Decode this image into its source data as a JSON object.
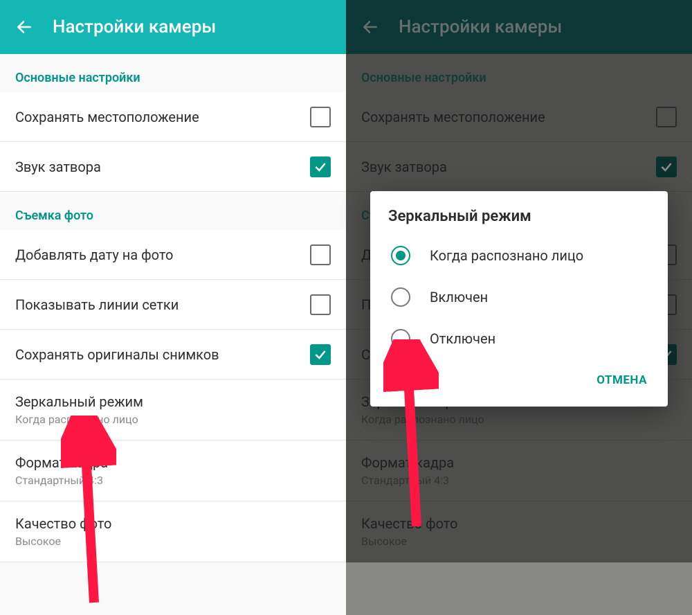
{
  "left": {
    "header": {
      "title": "Настройки камеры"
    },
    "sections": {
      "basic": {
        "title": "Основные настройки",
        "items": [
          {
            "label": "Сохранять местоположение",
            "checked": false
          },
          {
            "label": "Звук затвора",
            "checked": true
          }
        ]
      },
      "photo": {
        "title": "Съемка фото",
        "items": [
          {
            "label": "Добавлять дату на фото",
            "checked": false
          },
          {
            "label": "Показывать линии сетки",
            "checked": false
          },
          {
            "label": "Сохранять оригиналы снимков",
            "checked": true
          }
        ],
        "subitems": [
          {
            "label": "Зеркальный режим",
            "sub": "Когда распознано лицо"
          },
          {
            "label": "Формат кадра",
            "sub": "Стандартный 4:3"
          },
          {
            "label": "Качество фото",
            "sub": "Высокое"
          }
        ]
      }
    }
  },
  "right": {
    "header": {
      "title": "Настройки камеры"
    },
    "dialog": {
      "title": "Зеркальный режим",
      "options": [
        {
          "label": "Когда распознано лицо",
          "selected": true
        },
        {
          "label": "Включен",
          "selected": false
        },
        {
          "label": "Отключен",
          "selected": false
        }
      ],
      "cancel": "ОТМЕНА"
    }
  },
  "colors": {
    "accent": "#009688",
    "titlebar": "#14b7b3",
    "arrow": "#ff1744"
  }
}
